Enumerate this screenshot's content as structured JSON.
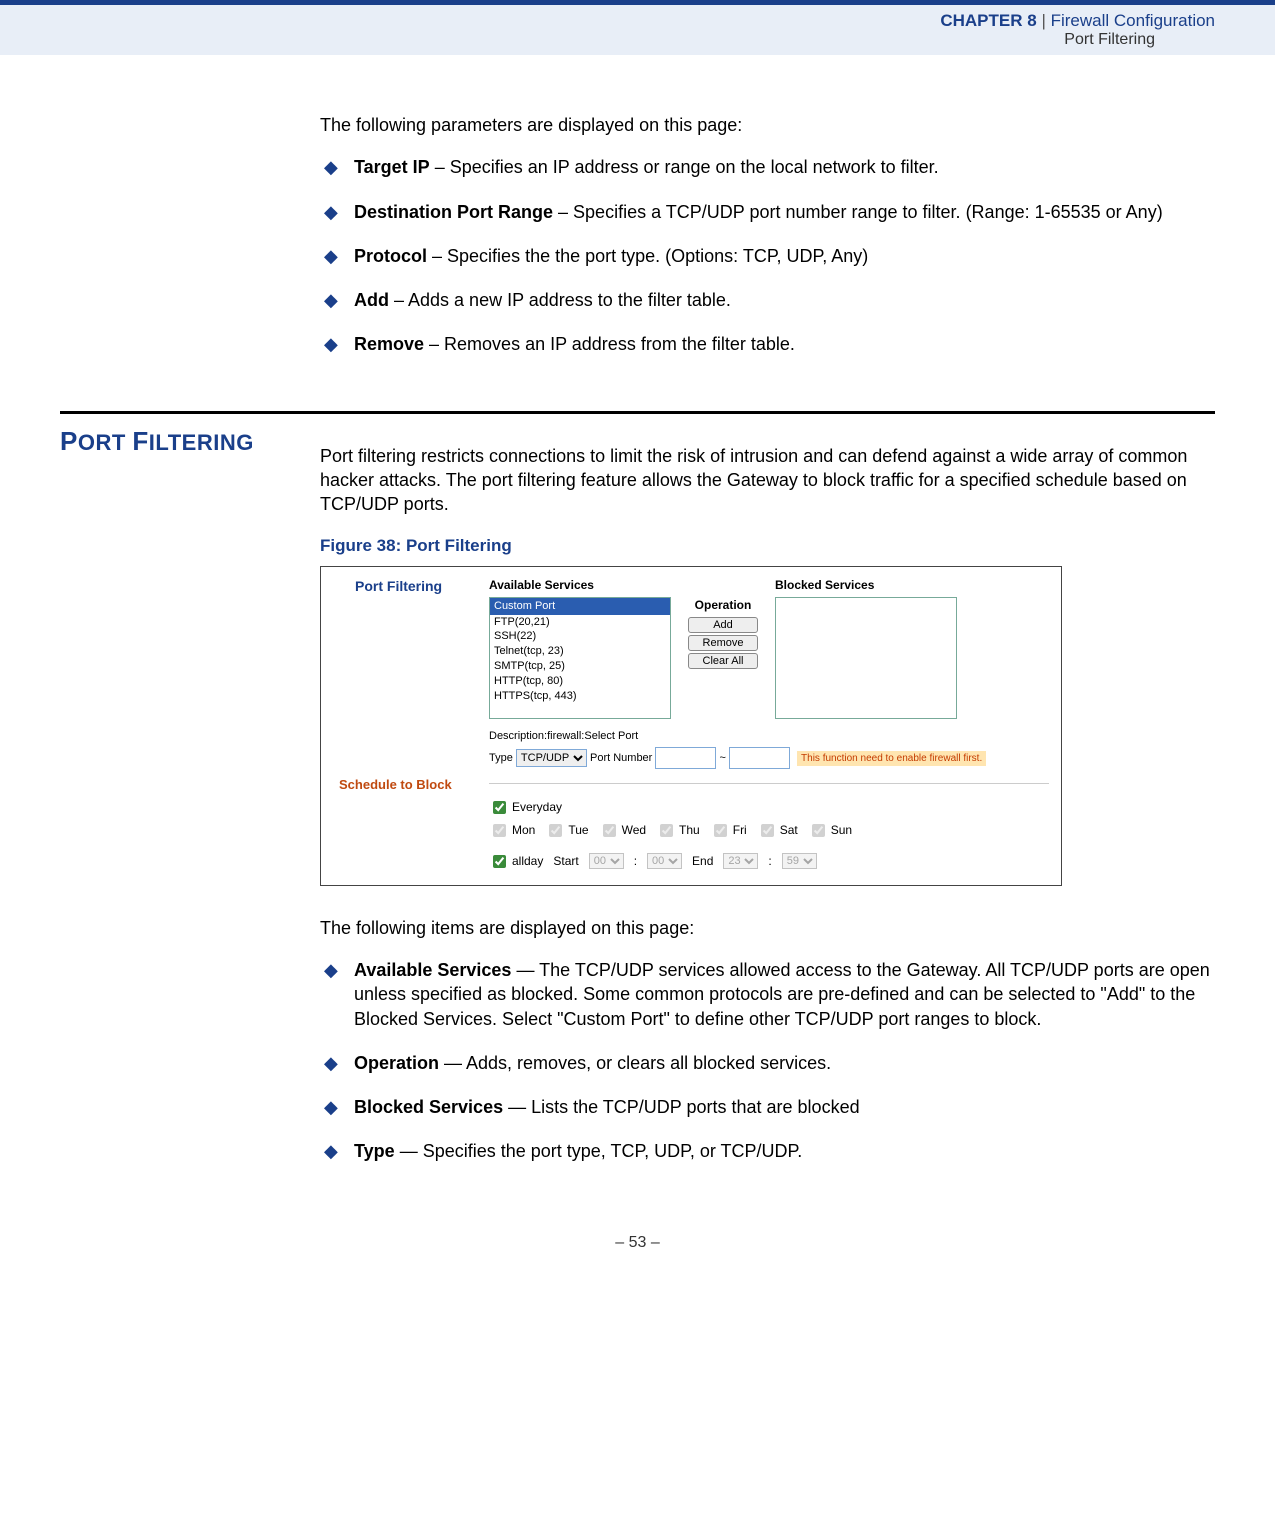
{
  "header": {
    "chapter": "CHAPTER 8",
    "sep": "|",
    "title": "Firewall Configuration",
    "subtitle": "Port Filtering"
  },
  "intro1": "The following parameters are displayed on this page:",
  "list1": [
    {
      "term": "Target IP",
      "desc": " – Specifies an IP address or range on the local network to filter."
    },
    {
      "term": "Destination Port Range",
      "desc": " – Specifies a TCP/UDP port number range to filter. (Range: 1-65535 or Any)"
    },
    {
      "term": "Protocol",
      "desc": " – Specifies the the port type. (Options: TCP, UDP, Any)"
    },
    {
      "term": "Add",
      "desc": " – Adds a new IP address to the filter table."
    },
    {
      "term": "Remove",
      "desc": " – Removes an IP address from the filter table."
    }
  ],
  "section_title": "PORT FILTERING",
  "para2": "Port filtering restricts connections to limit the risk of intrusion and can defend against a wide array of common hacker attacks. The port filtering feature allows the Gateway to block traffic for a specified schedule based on TCP/UDP ports.",
  "figure_caption": "Figure 38:  Port Filtering",
  "fig": {
    "side_title": "Port Filtering",
    "side_schedule": "Schedule to Block",
    "col_available": "Available Services",
    "col_operation": "Operation",
    "col_blocked": "Blocked Services",
    "services": [
      "Custom Port",
      "FTP(20,21)",
      "SSH(22)",
      "Telnet(tcp, 23)",
      "SMTP(tcp, 25)",
      "HTTP(tcp, 80)",
      "HTTPS(tcp, 443)"
    ],
    "btn_add": "Add",
    "btn_remove": "Remove",
    "btn_clear": "Clear All",
    "desc_label": "Description:firewall:Select Port",
    "type_label": "Type",
    "type_value": "TCP/UDP",
    "portnum_label": "Port Number",
    "tilde": "~",
    "warn": "This function need to enable firewall first.",
    "everyday": "Everyday",
    "days": [
      "Mon",
      "Tue",
      "Wed",
      "Thu",
      "Fri",
      "Sat",
      "Sun"
    ],
    "allday": "allday",
    "start": "Start",
    "end": "End",
    "t_h1": "00",
    "t_m1": "00",
    "t_h2": "23",
    "t_m2": "59",
    "colon": ":"
  },
  "intro3": "The following items are displayed on this page:",
  "list2": [
    {
      "term": "Available Services",
      "desc": " — The TCP/UDP services allowed access to the Gateway. All TCP/UDP ports are open unless specified as blocked. Some common protocols are pre-defined and can be selected to \"Add\" to the Blocked Services. Select \"Custom Port\" to define other TCP/UDP port ranges to block."
    },
    {
      "term": "Operation",
      "desc": " — Adds, removes, or clears all blocked services."
    },
    {
      "term": "Blocked Services",
      "desc": " — Lists the TCP/UDP ports that are blocked"
    },
    {
      "term": "Type",
      "desc": " — Specifies the port type, TCP, UDP, or TCP/UDP."
    }
  ],
  "footer": "–  53  –"
}
